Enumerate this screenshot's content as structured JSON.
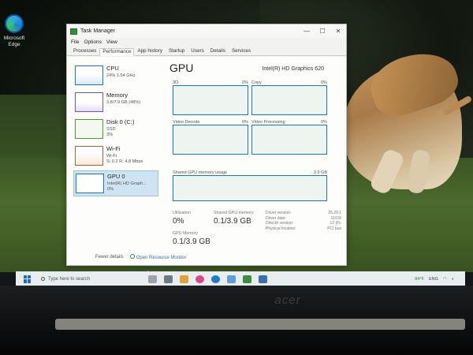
{
  "desktop": {
    "icon_label_line1": "Microsoft",
    "icon_label_line2": "Edge"
  },
  "window": {
    "title": "Task Manager",
    "menu": [
      "File",
      "Options",
      "View"
    ],
    "tabs": [
      "Processes",
      "Performance",
      "App history",
      "Startup",
      "Users",
      "Details",
      "Services"
    ],
    "active_tab": "Performance"
  },
  "sidebar": [
    {
      "name": "CPU",
      "sub1": "24%  1.54 GHz",
      "sub2": ""
    },
    {
      "name": "Memory",
      "sub1": "3.8/7.9 GB (48%)",
      "sub2": ""
    },
    {
      "name": "Disk 0 (C:)",
      "sub1": "SSD",
      "sub2": "3%"
    },
    {
      "name": "Wi-Fi",
      "sub1": "Wi-Fi",
      "sub2": "S: 0.2 R: 4.8 Mbps"
    },
    {
      "name": "GPU 0",
      "sub1": "Intel(R) HD Graph...",
      "sub2": "0%"
    }
  ],
  "main": {
    "title": "GPU",
    "model": "Intel(R) HD Graphics 620",
    "graphs": [
      {
        "label": "3D",
        "pct": "0%"
      },
      {
        "label": "Copy",
        "pct": "0%"
      },
      {
        "label": "Video Decode",
        "pct": "0%"
      },
      {
        "label": "Video Processing",
        "pct": "0%"
      }
    ],
    "shared_label": "Shared GPU memory usage",
    "shared_max": "3.9 GB",
    "stats": {
      "utilization_label": "Utilization",
      "utilization_value": "0%",
      "shared_mem_label": "Shared GPU memory",
      "shared_mem_value": "0.1/3.9 GB",
      "gpu_mem_label": "GPU Memory",
      "gpu_mem_value": "0.1/3.9 GB"
    },
    "details": [
      {
        "k": "Driver version:",
        "v": "25.20.1"
      },
      {
        "k": "Driver date:",
        "v": "11/19/"
      },
      {
        "k": "DirectX version:",
        "v": "12 (FL"
      },
      {
        "k": "Physical location:",
        "v": "PCI bus"
      }
    ]
  },
  "footer": {
    "fewer": "Fewer details",
    "open_monitor": "Open Resource Monitor"
  },
  "taskbar": {
    "search_placeholder": "Type here to search",
    "weather": "84°F",
    "tray_text": "ENG"
  }
}
